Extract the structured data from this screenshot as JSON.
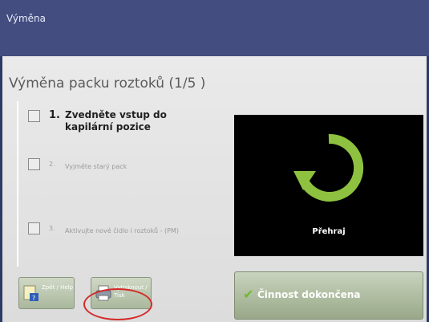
{
  "window": {
    "title": "Výměna"
  },
  "main": {
    "page_title": "Výměna packu roztoků (1/5 )"
  },
  "steps": [
    {
      "num": "1.",
      "text": "Zvedněte vstup do kapilární pozice"
    },
    {
      "num": "2.",
      "text": "Vyjměte starý pack"
    },
    {
      "num": "3.",
      "text": "Aktivujte nové čidlo i roztoků - (PM)"
    }
  ],
  "video": {
    "play_label": "Přehraj",
    "icon": "replay-icon",
    "accent_color": "#8ec13f"
  },
  "buttons": {
    "left_label": "Zpět / Help",
    "middle_label": "Vytisknout / Tisk",
    "done_label": "Činnost dokončena"
  },
  "colors": {
    "titlebar": "#434d80",
    "highlight": "#d42a2a",
    "check": "#6dbb2e"
  }
}
